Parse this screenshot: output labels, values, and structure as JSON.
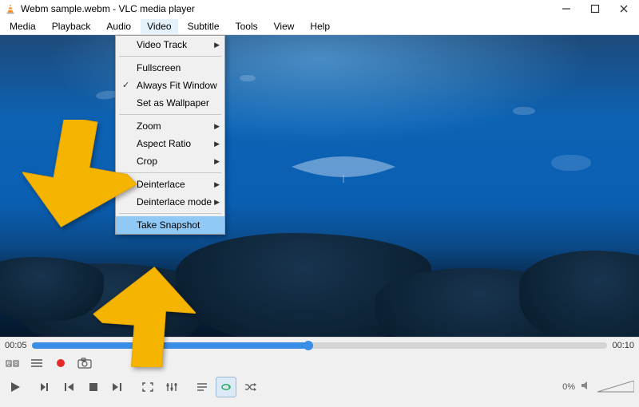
{
  "window": {
    "title": "Webm sample.webm - VLC media player"
  },
  "menu": {
    "items": [
      "Media",
      "Playback",
      "Audio",
      "Video",
      "Subtitle",
      "Tools",
      "View",
      "Help"
    ],
    "open_index": 3
  },
  "dropdown": {
    "video_track": "Video Track",
    "fullscreen": "Fullscreen",
    "always_fit": "Always Fit Window",
    "set_wallpaper": "Set as Wallpaper",
    "zoom": "Zoom",
    "aspect": "Aspect Ratio",
    "crop": "Crop",
    "deinterlace": "Deinterlace",
    "deinterlace_mode": "Deinterlace mode",
    "take_snapshot": "Take Snapshot"
  },
  "playback": {
    "current_time": "00:05",
    "total_time": "00:10",
    "progress_pct": 48
  },
  "volume": {
    "percent_label": "0%"
  }
}
